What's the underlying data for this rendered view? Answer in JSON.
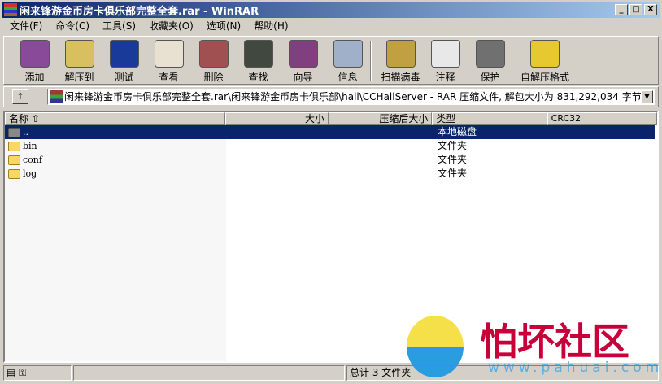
{
  "window": {
    "title": "闲来锋游金币房卡俱乐部完整全套.rar - WinRAR",
    "min": "_",
    "max": "□",
    "close": "X"
  },
  "menu": [
    "文件(F)",
    "命令(C)",
    "工具(S)",
    "收藏夹(O)",
    "选项(N)",
    "帮助(H)"
  ],
  "toolbar": [
    {
      "label": "添加",
      "icon": "add-archive-icon",
      "color": "#8a4a9a"
    },
    {
      "label": "解压到",
      "icon": "extract-icon",
      "color": "#d8c060"
    },
    {
      "label": "测试",
      "icon": "test-icon",
      "color": "#1a3a9a"
    },
    {
      "label": "查看",
      "icon": "view-icon",
      "color": "#e8e0d0"
    },
    {
      "label": "删除",
      "icon": "delete-icon",
      "color": "#a05050"
    },
    {
      "label": "查找",
      "icon": "find-icon",
      "color": "#404840"
    },
    {
      "label": "向导",
      "icon": "wizard-icon",
      "color": "#804080"
    },
    {
      "label": "信息",
      "icon": "info-icon",
      "color": "#a0b0c8"
    },
    {
      "label": "扫描病毒",
      "icon": "virus-scan-icon",
      "color": "#c0a040"
    },
    {
      "label": "注释",
      "icon": "comment-icon",
      "color": "#e8e8e8"
    },
    {
      "label": "保护",
      "icon": "protect-icon",
      "color": "#707070"
    },
    {
      "label": "自解压格式",
      "icon": "sfx-icon",
      "color": "#e8c830"
    }
  ],
  "address": {
    "up": "↑",
    "path": "闲来锋游金币房卡俱乐部完整全套.rar\\闲来锋游金币房卡俱乐部\\hall\\CCHallServer - RAR 压缩文件, 解包大小为 831,292,034 字节",
    "dropdown": "▼"
  },
  "columns": [
    "名称 ⇧",
    "大小",
    "压缩后大小",
    "类型",
    "CRC32"
  ],
  "rows": [
    {
      "name": "..",
      "type": "本地磁盘"
    },
    {
      "name": "bin",
      "type": "文件夹"
    },
    {
      "name": "conf",
      "type": "文件夹"
    },
    {
      "name": "log",
      "type": "文件夹"
    }
  ],
  "status": {
    "total": "总计 3 文件夹"
  },
  "watermark": {
    "text": "怕坏社区",
    "url": "www.pahuai.com"
  }
}
